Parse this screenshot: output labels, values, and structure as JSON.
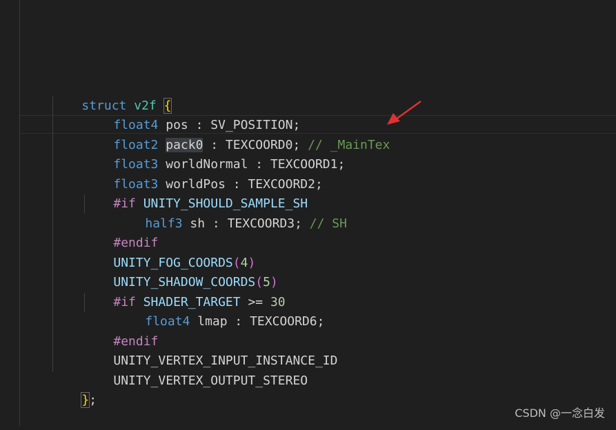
{
  "editor": {
    "lines": [
      {
        "tokens": [
          {
            "t": "struct",
            "c": "kw"
          },
          {
            "t": " ",
            "c": ""
          },
          {
            "t": "v2f",
            "c": "type"
          },
          {
            "t": " ",
            "c": ""
          },
          {
            "t": "{",
            "c": "brace brace-box"
          }
        ]
      },
      {
        "tokens": [
          {
            "t": "float4",
            "c": "ptype"
          },
          {
            "t": " pos : SV_POSITION;",
            "c": ""
          }
        ]
      },
      {
        "tokens": [
          {
            "t": "float2",
            "c": "ptype"
          },
          {
            "t": " ",
            "c": ""
          },
          {
            "t": "pack0",
            "c": "hl"
          },
          {
            "t": " : TEXCOORD0; ",
            "c": ""
          },
          {
            "t": "// _MainTex",
            "c": "com"
          }
        ]
      },
      {
        "tokens": [
          {
            "t": "float3",
            "c": "ptype"
          },
          {
            "t": " worldNormal : TEXCOORD1;",
            "c": ""
          }
        ]
      },
      {
        "tokens": [
          {
            "t": "float3",
            "c": "ptype"
          },
          {
            "t": " worldPos : TEXCOORD2;",
            "c": ""
          }
        ]
      },
      {
        "tokens": [
          {
            "t": "#if",
            "c": "pp"
          },
          {
            "t": " UNITY_SHOULD_SAMPLE_SH",
            "c": "macro"
          }
        ]
      },
      {
        "tokens": [
          {
            "t": "half3",
            "c": "ptype"
          },
          {
            "t": " sh : TEXCOORD3; ",
            "c": ""
          },
          {
            "t": "// SH",
            "c": "com"
          }
        ]
      },
      {
        "tokens": [
          {
            "t": "#endif",
            "c": "pp"
          }
        ]
      },
      {
        "tokens": [
          {
            "t": "UNITY_FOG_COORDS",
            "c": "macro"
          },
          {
            "t": "(",
            "c": "paren"
          },
          {
            "t": "4",
            "c": "num"
          },
          {
            "t": ")",
            "c": "paren"
          }
        ]
      },
      {
        "tokens": [
          {
            "t": "UNITY_SHADOW_COORDS",
            "c": "macro"
          },
          {
            "t": "(",
            "c": "paren"
          },
          {
            "t": "5",
            "c": "num"
          },
          {
            "t": ")",
            "c": "paren"
          }
        ]
      },
      {
        "tokens": [
          {
            "t": "#if",
            "c": "pp"
          },
          {
            "t": " ",
            "c": ""
          },
          {
            "t": "SHADER_TARGET",
            "c": "macro"
          },
          {
            "t": " >= ",
            "c": ""
          },
          {
            "t": "30",
            "c": "num"
          }
        ]
      },
      {
        "tokens": [
          {
            "t": "float4",
            "c": "ptype"
          },
          {
            "t": " lmap : TEXCOORD6;",
            "c": ""
          }
        ]
      },
      {
        "tokens": [
          {
            "t": "#endif",
            "c": "pp"
          }
        ]
      },
      {
        "tokens": [
          {
            "t": "UNITY_VERTEX_INPUT_INSTANCE_ID",
            "c": ""
          }
        ]
      },
      {
        "tokens": [
          {
            "t": "UNITY_VERTEX_OUTPUT_STEREO",
            "c": ""
          }
        ]
      },
      {
        "tokens": [
          {
            "t": "}",
            "c": "brace brace-box"
          },
          {
            "t": ";",
            "c": ""
          }
        ]
      }
    ]
  },
  "watermark": {
    "text": "CSDN @一念白发"
  },
  "colors": {
    "background": "#1f1f1f",
    "keyword": "#569cd6",
    "type": "#4ec9b0",
    "preprocessor": "#c586c0",
    "macro": "#9cdcfe",
    "number": "#b5cea8",
    "comment": "#6a9955",
    "brace": "#ffd700",
    "annotation_arrow": "#e03131"
  },
  "annotation": {
    "icon": "red-arrow-icon"
  }
}
